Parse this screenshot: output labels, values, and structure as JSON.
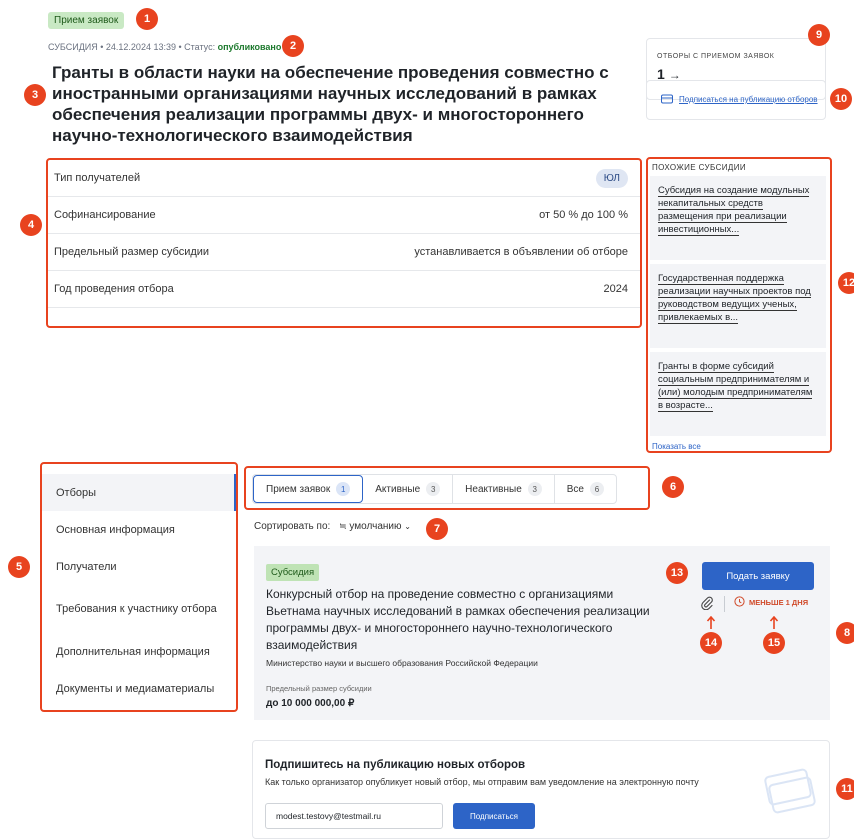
{
  "header": {
    "status_badge": "Прием заявок",
    "meta_prefix": "СУБСИДИЯ • 24.12.2024 13:39 • Статус: ",
    "meta_status": "опубликовано",
    "title": "Гранты в области науки на обеспечение проведения совместно с иностранными организациями научных исследований в рамках обеспечения реализации программы двух- и многостороннего научно-технологического взаимодействия"
  },
  "params": [
    {
      "label": "Тип получателей",
      "value": "ЮЛ"
    },
    {
      "label": "Софинансирование",
      "value": "от 50 % до 100 %"
    },
    {
      "label": "Предельный размер субсидии",
      "value": "устанавливается в объявлении об отборе"
    },
    {
      "label": "Год проведения отбора",
      "value": "2024"
    }
  ],
  "sidebar": {
    "selections_caption": "ОТБОРЫ С ПРИЕМОМ ЗАЯВОК",
    "selections_count": "1",
    "subscribe_link": "Подписаться на публикацию отборов",
    "similar_caption": "ПОХОЖИЕ СУБСИДИИ",
    "similar": [
      "Субсидия на создание модульных некапитальных средств размещения при реализации инвестиционных...",
      "Государственная поддержка реализации научных проектов под руководством ведущих ученых, привлекаемых в...",
      "Гранты в форме субсидий социальным предпринимателям и (или) молодым предпринимателям в возрасте..."
    ],
    "show_all": "Показать все"
  },
  "menu": [
    "Отборы",
    "Основная информация",
    "Получатели",
    "Требования к участнику отбора",
    "Дополнительная информация",
    "Документы и медиаматериалы"
  ],
  "tabs": [
    {
      "label": "Прием заявок",
      "count": "1"
    },
    {
      "label": "Активные",
      "count": "3"
    },
    {
      "label": "Неактивные",
      "count": "3"
    },
    {
      "label": "Все",
      "count": "6"
    }
  ],
  "sort": {
    "label": "Сортировать по:",
    "value": "умолчанию"
  },
  "card": {
    "chip": "Субсидия",
    "title": "Конкурсный отбор на проведение совместно с организациями Вьетнама научных исследований в рамках обеспечения реализации программы двух- и многостороннего научно-технологического взаимодействия",
    "ministry": "Министерство науки и высшего образования Российской Федерации",
    "limit_caption": "Предельный размер субсидии",
    "limit_value": "до 10 000 000,00 ₽",
    "apply_label": "Подать заявку",
    "timer_label": "МЕНЬШЕ 1 ДНЯ"
  },
  "subscribe": {
    "title": "Подпишитесь на публикацию новых отборов",
    "description": "Как только организатор опубликует новый отбор, мы отправим вам уведомление на электронную почту",
    "email": "modest.testovy@testmail.ru",
    "button": "Подписаться"
  },
  "markers": [
    "1",
    "2",
    "3",
    "4",
    "5",
    "6",
    "7",
    "8",
    "9",
    "10",
    "11",
    "12",
    "13",
    "14",
    "15"
  ],
  "colors": {
    "marker": "#e8431f",
    "accent": "#2d64c7",
    "status_green": "#c9e9c4"
  }
}
